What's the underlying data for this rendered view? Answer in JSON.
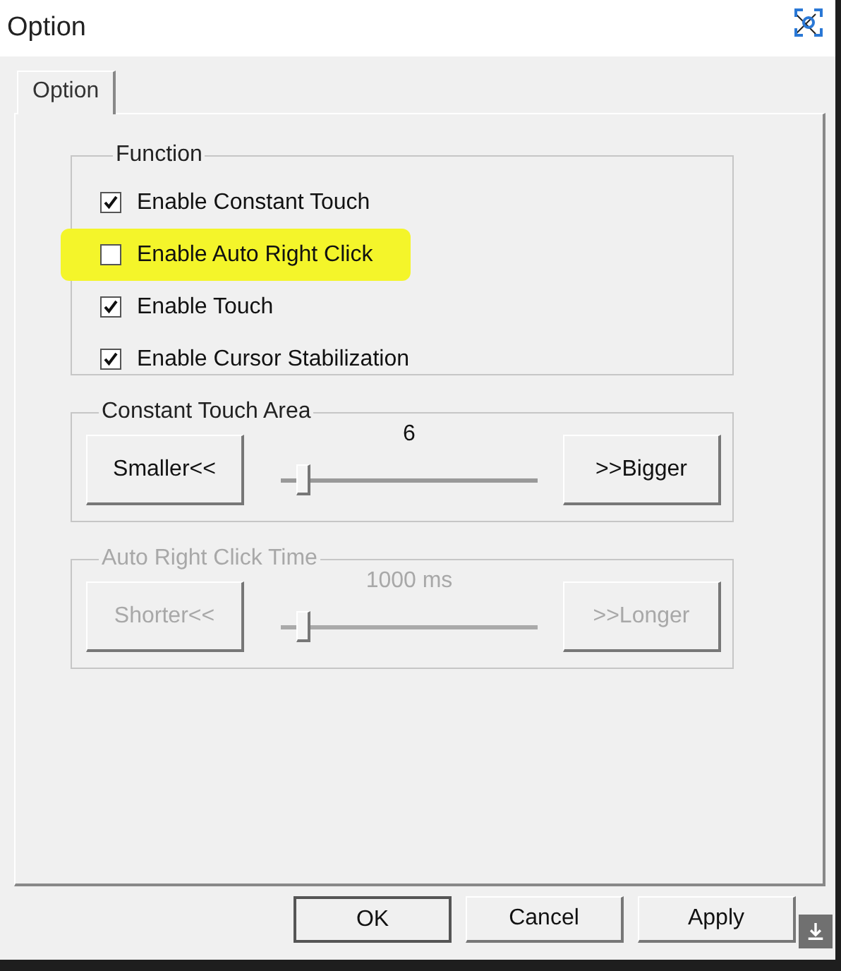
{
  "window": {
    "title": "Option"
  },
  "tabs": [
    {
      "label": "Option",
      "selected": true
    }
  ],
  "function_group": {
    "title": "Function",
    "options": [
      {
        "label": "Enable Constant Touch",
        "checked": true,
        "highlighted": false
      },
      {
        "label": "Enable Auto Right Click",
        "checked": false,
        "highlighted": true
      },
      {
        "label": "Enable Touch",
        "checked": true,
        "highlighted": false
      },
      {
        "label": "Enable Cursor Stabilization",
        "checked": true,
        "highlighted": false
      }
    ]
  },
  "slider_groups": [
    {
      "title": "Constant Touch Area",
      "disabled": false,
      "reading": "6",
      "level": 0.06,
      "decrease": "Smaller<<",
      "increase": ">>Bigger"
    },
    {
      "title": "Auto Right Click Time",
      "disabled": true,
      "reading": "1000 ms",
      "level": 0.06,
      "decrease": "Shorter<<",
      "increase": ">>Longer"
    }
  ],
  "buttons": [
    {
      "label": "OK",
      "default": true
    },
    {
      "label": "Cancel",
      "default": false
    },
    {
      "label": "Apply",
      "default": false
    }
  ]
}
